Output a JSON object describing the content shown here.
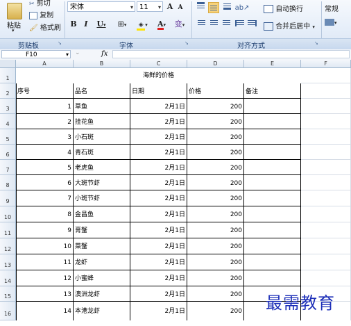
{
  "ribbon": {
    "clipboard": {
      "cut_label": "剪切",
      "copy_label": "复制",
      "paste_label": "粘贴",
      "format_painter_label": "格式刷",
      "group_label": "剪贴板"
    },
    "font": {
      "family": "宋体",
      "size": "11",
      "bold": "B",
      "italic": "I",
      "underline": "U",
      "grow": "A",
      "shrink": "A",
      "font_color": "A",
      "phonetic": "变",
      "group_label": "字体"
    },
    "alignment": {
      "wrap_label": "自动换行",
      "merge_label": "合并后居中",
      "group_label": "对齐方式"
    },
    "number": {
      "format": "常规"
    }
  },
  "formula_bar": {
    "name_box": "F10",
    "fx": "fx",
    "formula": ""
  },
  "sheet": {
    "columns": [
      "A",
      "B",
      "C",
      "D",
      "E",
      "F"
    ],
    "title": "海鲜的价格",
    "headers": [
      "序号",
      "品名",
      "日期",
      "价格",
      "备注"
    ],
    "rows": [
      {
        "num": "1",
        "name": "草鱼",
        "date": "2月1日",
        "price": "200"
      },
      {
        "num": "2",
        "name": "挂花鱼",
        "date": "2月1日",
        "price": "200"
      },
      {
        "num": "3",
        "name": "小石斑",
        "date": "2月1日",
        "price": "200"
      },
      {
        "num": "4",
        "name": "青石斑",
        "date": "2月1日",
        "price": "200"
      },
      {
        "num": "5",
        "name": "老虎鱼",
        "date": "2月1日",
        "price": "200"
      },
      {
        "num": "6",
        "name": "大斑节虾",
        "date": "2月1日",
        "price": "200"
      },
      {
        "num": "7",
        "name": "小斑节虾",
        "date": "2月1日",
        "price": "200"
      },
      {
        "num": "8",
        "name": "金昌鱼",
        "date": "2月1日",
        "price": "200"
      },
      {
        "num": "9",
        "name": "膏蟹",
        "date": "2月1日",
        "price": "200"
      },
      {
        "num": "10",
        "name": "菜蟹",
        "date": "2月1日",
        "price": "200"
      },
      {
        "num": "11",
        "name": "龙虾",
        "date": "2月1日",
        "price": "200"
      },
      {
        "num": "12",
        "name": "小蜜蜂",
        "date": "2月1日",
        "price": "200"
      },
      {
        "num": "13",
        "name": "澳洲龙虾",
        "date": "2月1日",
        "price": "200"
      },
      {
        "num": "14",
        "name": "本港龙虾",
        "date": "2月1日",
        "price": "200"
      }
    ],
    "row_numbers": [
      "1",
      "2",
      "3",
      "4",
      "5",
      "6",
      "7",
      "8",
      "9",
      "10",
      "11",
      "12",
      "13",
      "14",
      "15",
      "16"
    ]
  },
  "watermark": "最需教育"
}
